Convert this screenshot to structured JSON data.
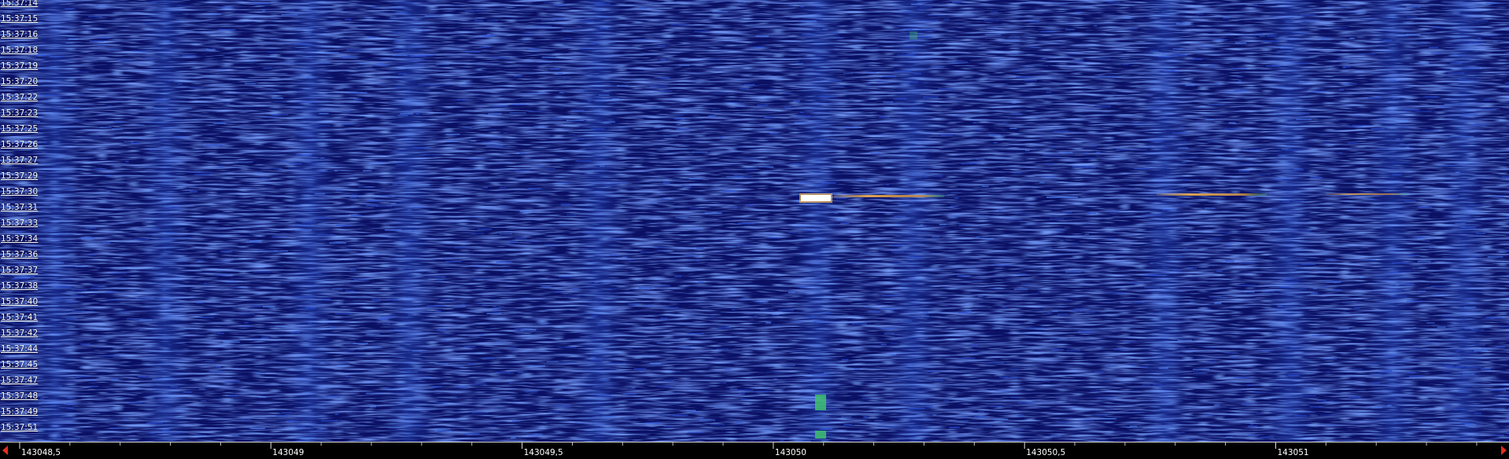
{
  "waterfall": {
    "time_labels": [
      "15:37:14",
      "15:37:15",
      "15:37:16",
      "15:37:18",
      "15:37:19",
      "15:37:20",
      "15:37:22",
      "15:37:23",
      "15:37:25",
      "15:37:26",
      "15:37:27",
      "15:37:29",
      "15:37:30",
      "15:37:31",
      "15:37:33",
      "15:37:34",
      "15:37:36",
      "15:37:37",
      "15:37:38",
      "15:37:40",
      "15:37:41",
      "15:37:42",
      "15:37:44",
      "15:37:45",
      "15:37:47",
      "15:37:48",
      "15:37:49",
      "15:37:51"
    ],
    "colors": {
      "background": "#0a1064",
      "noise": "#2a4fd6",
      "noise_bright": "#4a7cf0",
      "signal_hot": "#ffffff",
      "signal_warm": "#f0b050",
      "signal_green": "#40c070"
    }
  },
  "freq_axis": {
    "labels": [
      "143048,5",
      "143049",
      "143049,5",
      "143050",
      "143050,5",
      "143051"
    ],
    "start": 143048.5,
    "end": 143051.4,
    "scroll_left_icon": "left-arrow-icon",
    "scroll_right_icon": "right-arrow-icon"
  }
}
